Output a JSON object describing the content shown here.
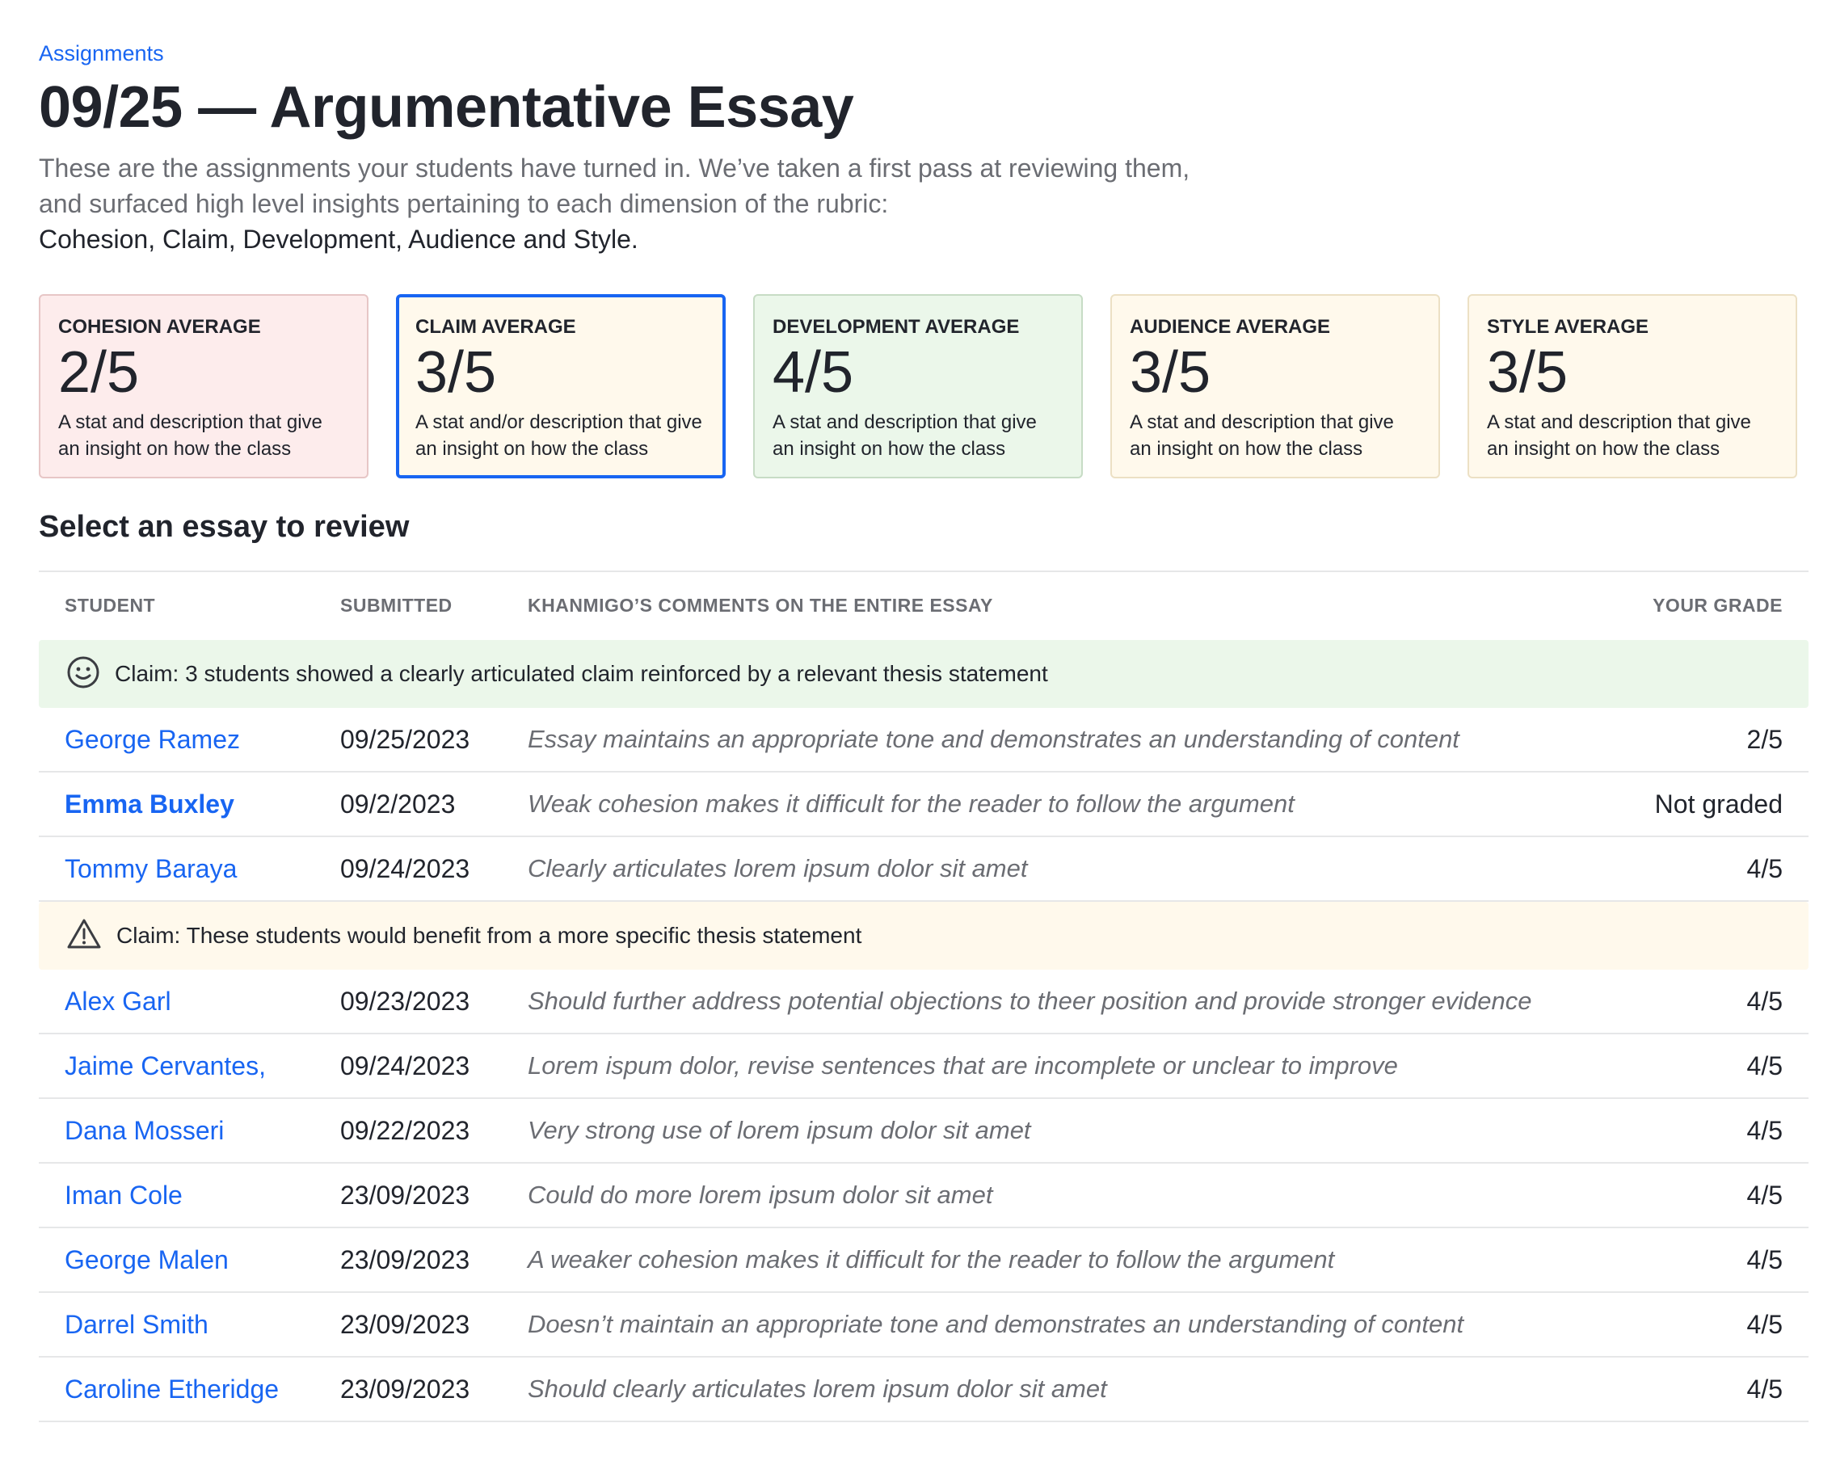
{
  "breadcrumb": "Assignments",
  "title": "09/25 — Argumentative Essay",
  "description": "These are the assignments your students have turned in. We’ve taken a first pass at reviewing them, and surfaced high level insights pertaining to each dimension of the rubric:",
  "rubric_dimensions": "Cohesion, Claim, Development, Audience and Style.",
  "cards": [
    {
      "label": "COHESION AVERAGE",
      "value": "2/5",
      "desc": "A stat and description that give an insight on how the class",
      "color": "#fdecec"
    },
    {
      "label": "CLAIM AVERAGE",
      "value": "3/5",
      "desc": "A stat and/or description that give an insight on how the class",
      "color": "#fff9ec",
      "selected": true
    },
    {
      "label": "DEVELOPMENT AVERAGE",
      "value": "4/5",
      "desc": "A stat and description that give an insight on how the class",
      "color": "#ebf7ea"
    },
    {
      "label": "AUDIENCE AVERAGE",
      "value": "3/5",
      "desc": "A stat and description that give an insight on how the class",
      "color": "#fff9ec"
    },
    {
      "label": "STYLE AVERAGE",
      "value": "3/5",
      "desc": "A stat and description that give an insight on how the class",
      "color": "#fff9ec"
    }
  ],
  "section_title": "Select an essay to review",
  "table": {
    "headers": {
      "student": "STUDENT",
      "submitted": "SUBMITTED",
      "comments": "KHANMIGO’S COMMENTS ON THE ENTIRE ESSAY",
      "grade": "YOUR GRADE"
    },
    "groups": [
      {
        "icon": "smiley-icon",
        "text": "Claim: 3 students showed a clearly articulated claim reinforced by a relevant thesis statement",
        "rows": [
          {
            "student": "George Ramez",
            "submitted": "09/25/2023",
            "comment": "Essay maintains an appropriate tone and demonstrates an understanding of content",
            "grade": "2/5"
          },
          {
            "student": "Emma Buxley",
            "submitted": "09/2/2023",
            "comment": "Weak cohesion makes it difficult for the reader to follow the argument",
            "grade": "Not graded"
          },
          {
            "student": "Tommy Baraya",
            "submitted": "09/24/2023",
            "comment": "Clearly articulates lorem ipsum dolor sit amet",
            "grade": "4/5"
          }
        ]
      },
      {
        "icon": "warning-icon",
        "text": "Claim: These students would benefit from a more specific thesis statement",
        "rows": [
          {
            "student": "Alex Garl",
            "submitted": "09/23/2023",
            "comment": "Should further address potential objections to theer position and provide stronger evidence",
            "grade": "4/5"
          },
          {
            "student": "Jaime Cervantes,",
            "submitted": "09/24/2023",
            "comment": "Lorem ispum dolor, revise sentences that are incomplete or unclear to improve",
            "grade": "4/5"
          },
          {
            "student": "Dana Mosseri",
            "submitted": "09/22/2023",
            "comment": "Very strong use of lorem ipsum dolor sit amet",
            "grade": "4/5"
          },
          {
            "student": "Iman Cole",
            "submitted": "23/09/2023",
            "comment": "Could do  more lorem ipsum dolor sit amet",
            "grade": "4/5"
          },
          {
            "student": "George Malen",
            "submitted": "23/09/2023",
            "comment": "A weaker  cohesion makes it difficult for the reader to follow the argument",
            "grade": "4/5"
          },
          {
            "student": "Darrel Smith",
            "submitted": "23/09/2023",
            "comment": "Doesn’t maintain an appropriate tone and demonstrates an understanding of content",
            "grade": "4/5"
          },
          {
            "student": "Caroline Etheridge",
            "submitted": "23/09/2023",
            "comment": "Should clearly articulates lorem ipsum dolor sit amet",
            "grade": "4/5"
          }
        ]
      }
    ]
  }
}
